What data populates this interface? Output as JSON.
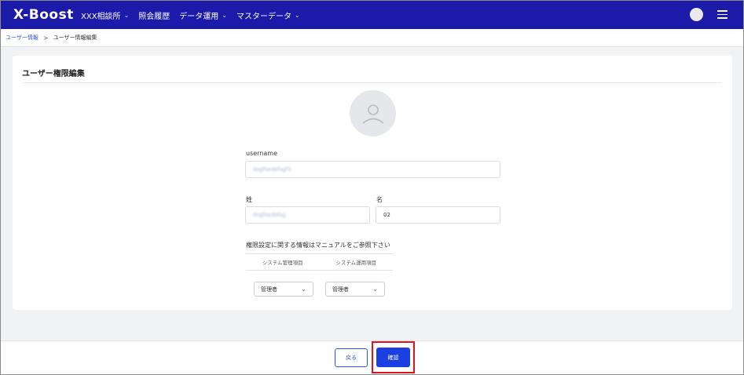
{
  "app": {
    "logo": "X-Boost",
    "nav": [
      {
        "label": "XXX相談所",
        "has_dropdown": true
      },
      {
        "label": "照会履歴",
        "has_dropdown": false
      },
      {
        "label": "データ運用",
        "has_dropdown": true
      },
      {
        "label": "マスターデータ",
        "has_dropdown": true
      }
    ]
  },
  "breadcrumb": {
    "parent": "ユーザー情報",
    "separator": ">",
    "current": "ユーザー情報編集"
  },
  "card": {
    "title": "ユーザー権限編集",
    "username_label": "username",
    "username_value": "dsgfsedsfsgf3",
    "last_name_label": "姓",
    "last_name_value": "dsgfsedsfsg",
    "first_name_label": "名",
    "first_name_value": "02",
    "permission_note": "権限設定に関する情報はマニュアルをご参照下さい",
    "permission_columns": [
      "システム管理項目",
      "システム運用項目"
    ],
    "permission_values": [
      "管理者",
      "管理者"
    ]
  },
  "footer": {
    "back_label": "戻る",
    "confirm_label": "確認"
  },
  "colors": {
    "nav_bg": "#1c1aa8",
    "primary": "#1b3fe0",
    "link": "#2f55d4",
    "highlight": "#e0121c"
  }
}
